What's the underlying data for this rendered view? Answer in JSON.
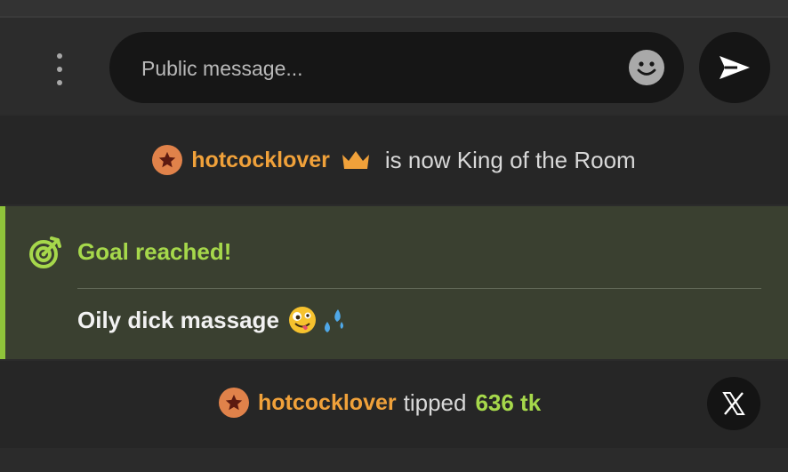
{
  "composer": {
    "placeholder": "Public message...",
    "icons": {
      "menu": "kebab-menu-icon",
      "emoji": "smiley-icon",
      "send": "send-icon"
    }
  },
  "king_notice": {
    "username": "hotcocklover",
    "message": "is now King of the Room",
    "icons": {
      "badge": "star-badge-icon",
      "crown": "crown-icon"
    }
  },
  "goal": {
    "title": "Goal reached!",
    "description": "Oily dick massage",
    "emojis": [
      "zany-face-emoji",
      "sweat-droplets-emoji"
    ],
    "icon": "target-icon"
  },
  "tip_notice": {
    "username": "hotcocklover",
    "verb": "tipped",
    "amount": "636 tk",
    "close_icon": "x-close-icon"
  },
  "colors": {
    "username": "#f0a13a",
    "goal_accent": "#a6d84b",
    "goal_bg": "#3a4030",
    "badge": "#e0824a"
  }
}
